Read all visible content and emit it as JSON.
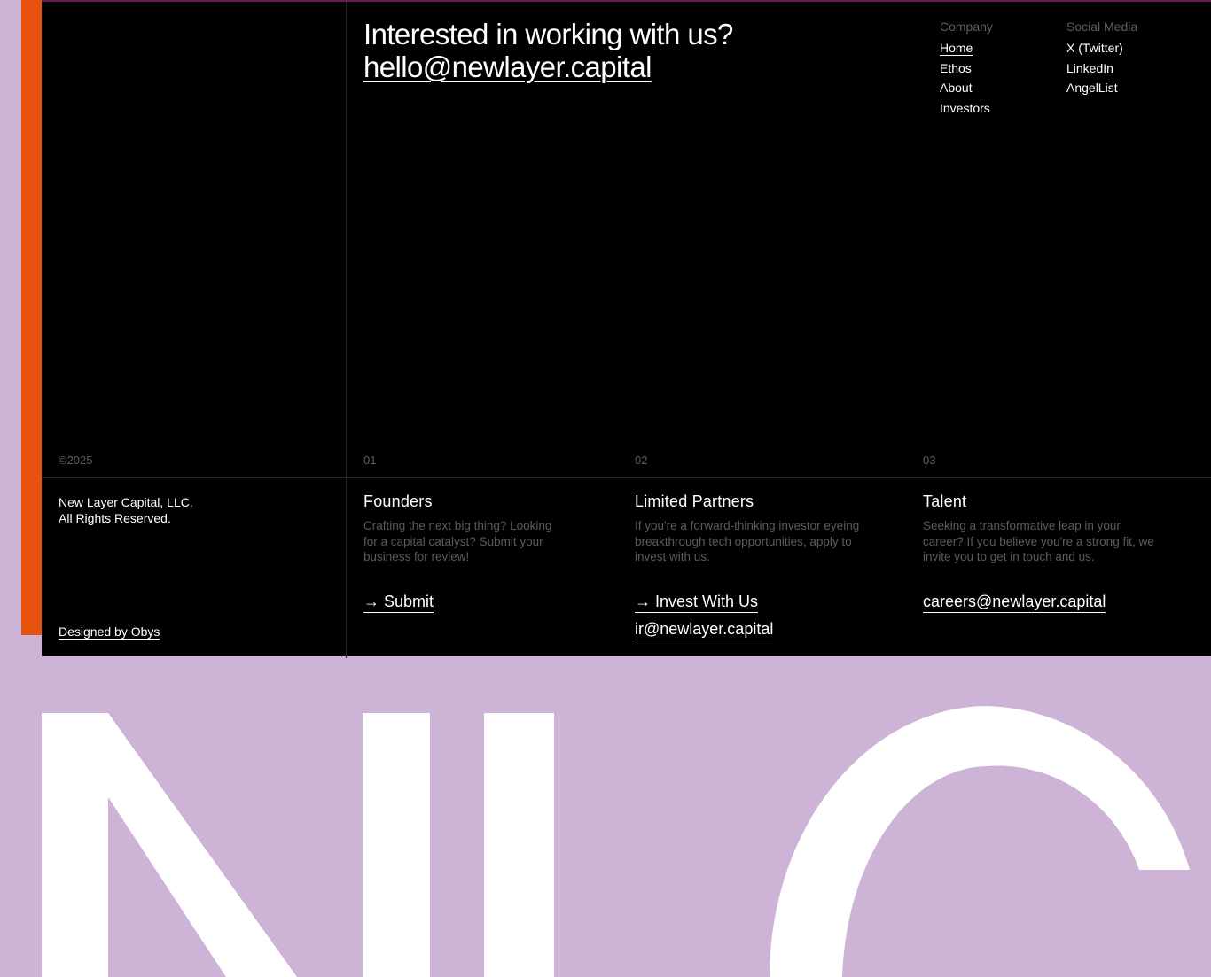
{
  "footer": {
    "headline": "Interested in working with us?",
    "headline_email": "hello@newlayer.capital",
    "nav": {
      "company_heading": "Company",
      "company_links": [
        "Home",
        "Ethos",
        "About",
        "Investors"
      ],
      "social_heading": "Social Media",
      "social_links": [
        "X (Twitter)",
        "LinkedIn",
        "AngelList"
      ]
    },
    "copyright": "©2025",
    "legal_line1": "New Layer Capital, LLC.",
    "legal_line2": "All Rights Reserved.",
    "designed_by": "Designed by Obys",
    "columns": [
      {
        "number": "01",
        "title": "Founders",
        "description": "Crafting the next big thing? Looking for a capital catalyst? Submit your business for review!",
        "cta": "→ Submit"
      },
      {
        "number": "02",
        "title": "Limited Partners",
        "description": "If you're a forward-thinking investor eyeing breakthrough tech opportunities, apply to invest with us.",
        "cta": "→ Invest With Us",
        "email": "ir@newlayer.capital"
      },
      {
        "number": "03",
        "title": "Talent",
        "description": "Seeking a transformative leap in your career? If you believe you're a strong fit, we invite you to get in touch and us.",
        "email": "careers@newlayer.capital"
      }
    ]
  },
  "brand_wordmark": "NLC",
  "colors": {
    "background": "#cdb4d6",
    "panel": "#000000",
    "accent_strip": "#e8520f",
    "muted_text": "#5e5e5e"
  }
}
